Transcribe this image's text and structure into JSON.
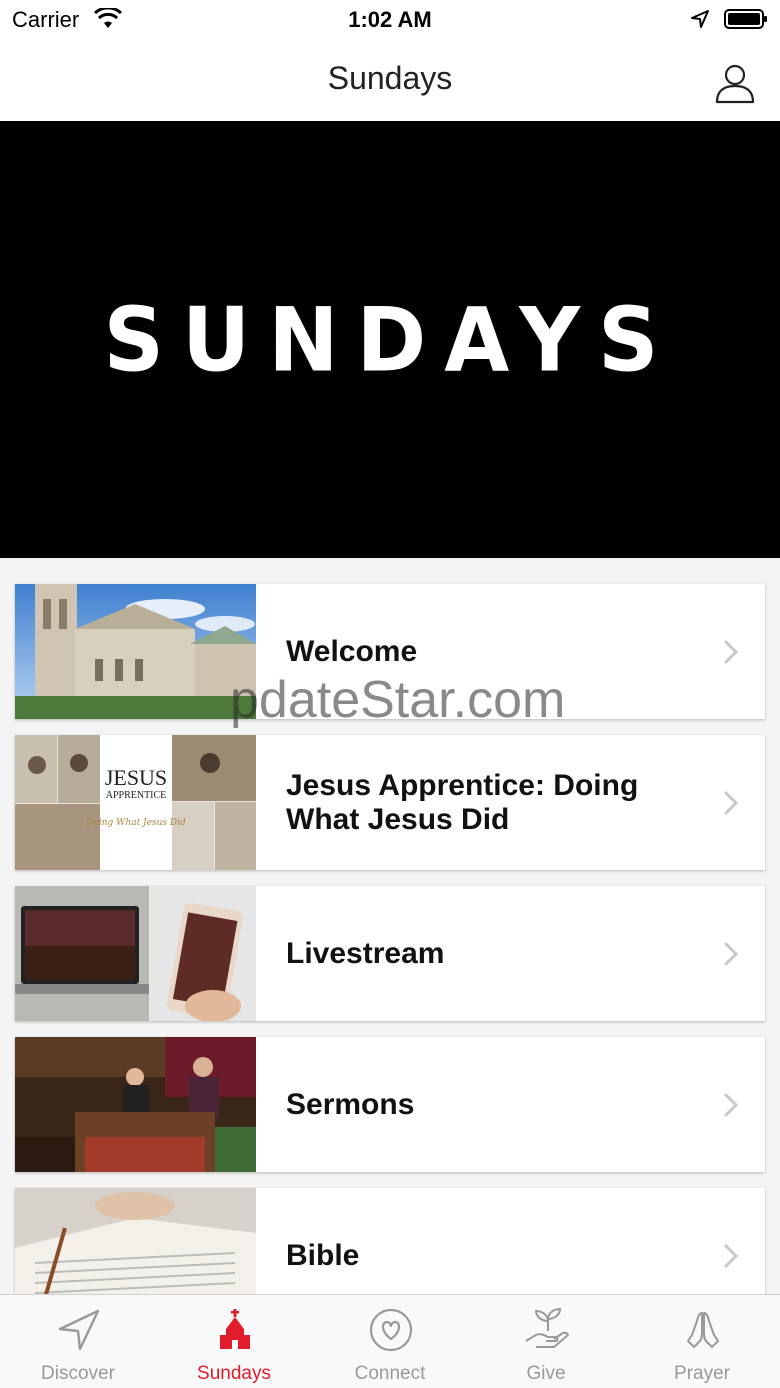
{
  "status_bar": {
    "carrier": "Carrier",
    "time": "1:02 AM"
  },
  "nav": {
    "title": "Sundays"
  },
  "hero": {
    "text": "SUNDAYS"
  },
  "items": [
    {
      "title": "Welcome"
    },
    {
      "title": "Jesus Apprentice: Doing What Jesus Did",
      "thumb_title": "JESUS",
      "thumb_subtitle": "APPRENTICE",
      "thumb_script": "Doing What Jesus Did"
    },
    {
      "title": "Livestream"
    },
    {
      "title": "Sermons"
    },
    {
      "title": "Bible"
    }
  ],
  "watermark": "pdateStar.com",
  "tabs": [
    {
      "label": "Discover",
      "icon": "navigation-arrow-icon"
    },
    {
      "label": "Sundays",
      "icon": "church-icon",
      "active": true
    },
    {
      "label": "Connect",
      "icon": "heart-circle-icon"
    },
    {
      "label": "Give",
      "icon": "hand-plant-icon"
    },
    {
      "label": "Prayer",
      "icon": "praying-hands-icon"
    }
  ],
  "colors": {
    "accent": "#e11d2b",
    "inactive": "#999999",
    "hero_bg": "#000000"
  }
}
